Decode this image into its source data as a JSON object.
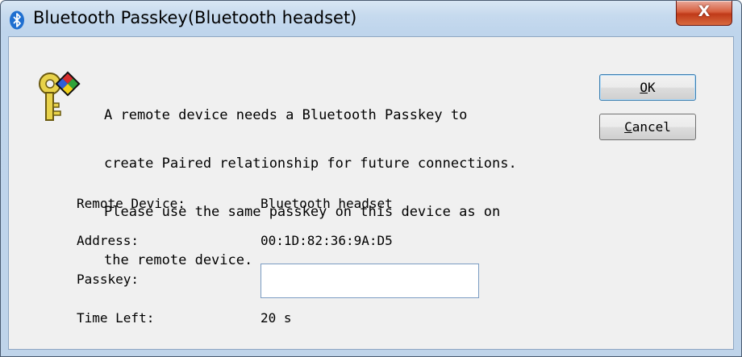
{
  "window": {
    "title": "Bluetooth Passkey(Bluetooth headset)",
    "close_label": "X"
  },
  "message": {
    "line1": "A remote device needs a Bluetooth Passkey to",
    "line2": "create Paired relationship for future connections.",
    "line3": "Please use the same passkey on this device as on",
    "line4": "the remote device."
  },
  "buttons": {
    "ok": {
      "mnemonic": "O",
      "rest": "K"
    },
    "cancel": {
      "mnemonic": "C",
      "rest": "ancel"
    }
  },
  "fields": {
    "remote_device_label": "Remote Device:",
    "remote_device_value": "Bluetooth headset",
    "address_label": "Address:",
    "address_value": "00:1D:82:36:9A:D5",
    "passkey_label": "Passkey:",
    "passkey_value": "",
    "time_left_label": "Time Left:",
    "time_left_value": "20 s"
  },
  "icons": {
    "title": "bluetooth-icon",
    "dialog": "key-icon"
  },
  "colors": {
    "titlebar": "#c6daee",
    "client_bg": "#f0f0f0",
    "close_button": "#c03a19",
    "bluetooth_blue": "#1f6fd0"
  }
}
